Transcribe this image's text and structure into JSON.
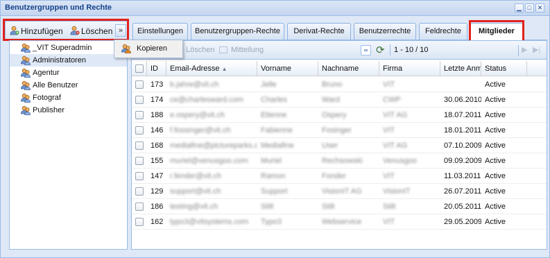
{
  "window": {
    "title": "Benutzergruppen und Rechte",
    "controls": [
      "minimize",
      "maximize",
      "close"
    ]
  },
  "left_toolbar": {
    "add_label": "Hinzufügen",
    "delete_label": "Löschen",
    "more_label": "»"
  },
  "context_menu": {
    "items": [
      {
        "label": "Kopieren"
      }
    ]
  },
  "groups": [
    {
      "label": "_VIT Superadmin"
    },
    {
      "label": "Administratoren",
      "selected": true
    },
    {
      "label": "Agentur"
    },
    {
      "label": "Alle Benutzer"
    },
    {
      "label": "Fotograf"
    },
    {
      "label": "Publisher"
    }
  ],
  "tabs": [
    {
      "label": "Einstellungen"
    },
    {
      "label": "Benutzergruppen-Rechte"
    },
    {
      "label": "Derivat-Rechte"
    },
    {
      "label": "Benutzerrechte"
    },
    {
      "label": "Feldrechte"
    },
    {
      "label": "Mitglieder",
      "active": true
    }
  ],
  "grid_toolbar": {
    "delete_label": "Löschen",
    "notify_label": "Mitteilung",
    "pager": "1 - 10 / 10"
  },
  "grid": {
    "columns": [
      "ID",
      "Email-Adresse",
      "Vorname",
      "Nachname",
      "Firma",
      "Letzte Anm",
      "Status"
    ],
    "rows": [
      {
        "id": "173",
        "email": "b.jahre@vit.ch",
        "first": "Jelle",
        "last": "Bruno",
        "company": "VIT",
        "last_login": "",
        "status": "Active"
      },
      {
        "id": "174",
        "email": "ce@charlesward.com",
        "first": "Charles",
        "last": "Ward",
        "company": "CWP",
        "last_login": "30.06.2010",
        "status": "Active"
      },
      {
        "id": "188",
        "email": "e.ospery@vit.ch",
        "first": "Etienne",
        "last": "Ospery",
        "company": "VIT AG",
        "last_login": "18.07.2011",
        "status": "Active"
      },
      {
        "id": "146",
        "email": "f.fossinger@vit.ch",
        "first": "Fabienne",
        "last": "Fosinger",
        "company": "VIT",
        "last_login": "18.01.2011",
        "status": "Active"
      },
      {
        "id": "168",
        "email": "mediafine@pictureparks.com",
        "first": "Mediafine",
        "last": "User",
        "company": "VIT AG",
        "last_login": "07.10.2009",
        "status": "Active"
      },
      {
        "id": "155",
        "email": "muriel@venusgoo.com",
        "first": "Muriel",
        "last": "Rechsowski",
        "company": "Venusgoo",
        "last_login": "09.09.2009",
        "status": "Active"
      },
      {
        "id": "147",
        "email": "r.fender@vit.ch",
        "first": "Ramon",
        "last": "Fonder",
        "company": "VIT",
        "last_login": "11.03.2011",
        "status": "Active"
      },
      {
        "id": "129",
        "email": "support@vit.ch",
        "first": "Support",
        "last": "VisionIT AG",
        "company": "VisionIT",
        "last_login": "26.07.2011",
        "status": "Active"
      },
      {
        "id": "186",
        "email": "testing@vit.ch",
        "first": "Stilt",
        "last": "Stilt",
        "company": "Stilt",
        "last_login": "20.05.2011",
        "status": "Active"
      },
      {
        "id": "162",
        "email": "typo3@vitsystems.com",
        "first": "Typo3",
        "last": "Webservice",
        "company": "VIT",
        "last_login": "29.05.2009",
        "status": "Active"
      }
    ]
  }
}
